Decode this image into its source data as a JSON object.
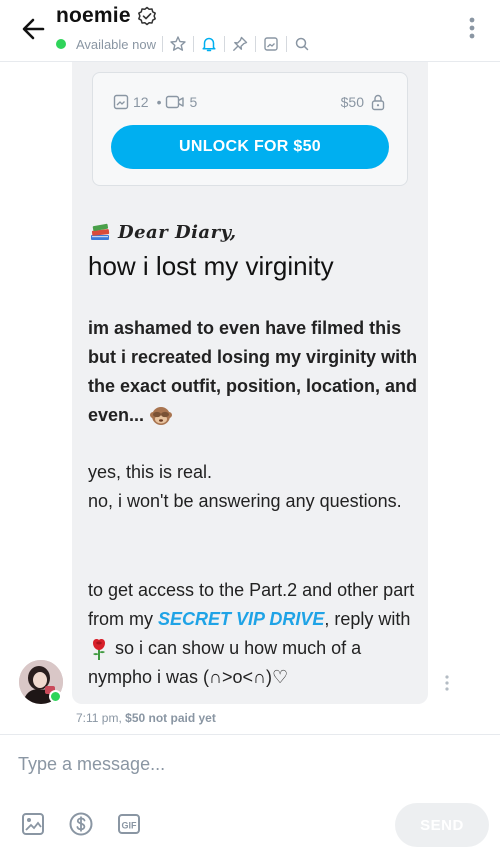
{
  "header": {
    "name": "noemie",
    "status": "Available now"
  },
  "locked_media": {
    "image_count": "12",
    "separator": "•",
    "video_count": "5",
    "price": "$50",
    "unlock_label": "UNLOCK FOR $50"
  },
  "message": {
    "greeting": "Dear Diary,",
    "title": "how i lost my virginity",
    "p1": "im ashamed to even have filmed this but i recreated losing my virginity with the exact outfit, position, location, and even...",
    "p2_line1": "yes, this is real.",
    "p2_line2": "no, i won't be answering any questions.",
    "p3_before": "to get access to the Part.2 and other part from my ",
    "p3_link": "SECRET VIP DRIVE",
    "p3_mid": ", reply with ",
    "p3_after": " so i can show u how much of a nympho i was (∩˃o˂∩)♡",
    "time": "7:11 pm,",
    "payment_status": "$50 not paid yet"
  },
  "composer": {
    "placeholder": "Type a message...",
    "send_label": "SEND"
  },
  "colors": {
    "accent": "#00aff0",
    "online": "#2fd45a",
    "muted": "#8a96a3",
    "bubble": "#f0f1f3"
  },
  "icons": [
    "back-arrow-icon",
    "verified-icon",
    "star-icon",
    "bell-icon",
    "pin-icon",
    "image-icon",
    "search-icon",
    "more-vertical-icon",
    "video-icon",
    "lock-icon",
    "books-emoji",
    "monkey-emoji",
    "rose-emoji",
    "dollar-icon",
    "gif-icon"
  ]
}
